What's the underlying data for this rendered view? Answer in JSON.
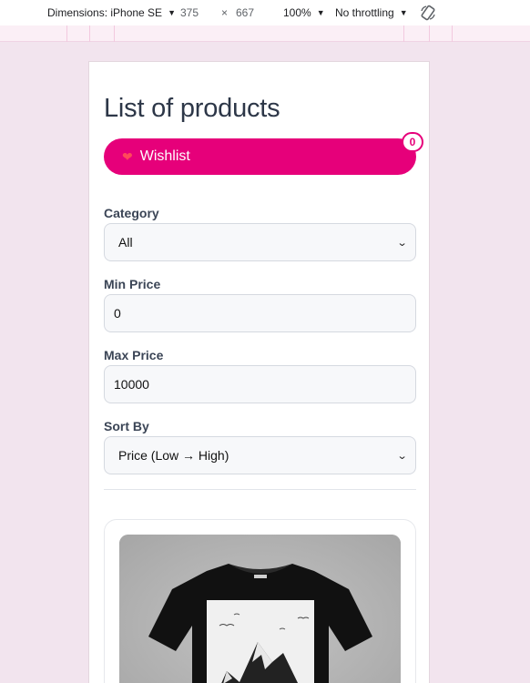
{
  "devtools": {
    "dimensions_label": "Dimensions: iPhone SE",
    "width": "375",
    "times": "×",
    "height": "667",
    "zoom": "100%",
    "throttling": "No throttling",
    "rotate_icon": "rotate-icon"
  },
  "page": {
    "title": "List of products",
    "wishlist": {
      "label": "Wishlist",
      "icon": "heart-icon",
      "count": "0",
      "color": "#e6007a"
    }
  },
  "filters": {
    "category": {
      "label": "Category",
      "value": "All"
    },
    "min_price": {
      "label": "Min Price",
      "value": "0"
    },
    "max_price": {
      "label": "Max Price",
      "value": "10000"
    },
    "sort_by": {
      "label": "Sort By",
      "value": "Price (Low → High)"
    }
  },
  "products": [
    {
      "image": "black-tshirt-mountain-print"
    }
  ]
}
